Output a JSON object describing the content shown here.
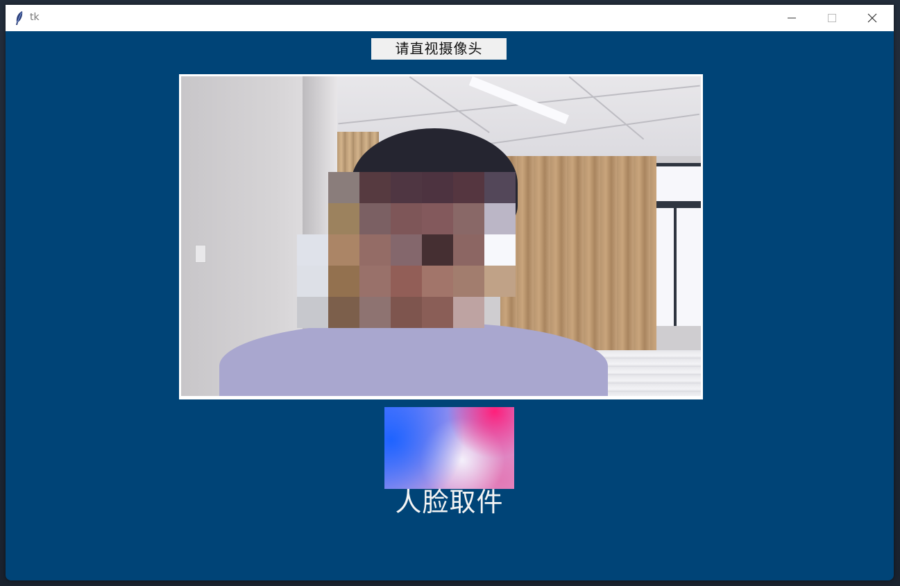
{
  "window": {
    "title": "tk",
    "icon": "tk-feather-icon"
  },
  "prompt": {
    "text": "请直视摄像头"
  },
  "camera": {
    "description_icon": "camera-feed"
  },
  "capture": {
    "label": "人脸取件"
  },
  "controls": {
    "minimize_icon": "minimize-icon",
    "maximize_icon": "maximize-icon",
    "close_icon": "close-icon"
  },
  "colors": {
    "window_background": "#004477",
    "titlebar": "#ffffff",
    "label_background": "#f0f0f0"
  }
}
